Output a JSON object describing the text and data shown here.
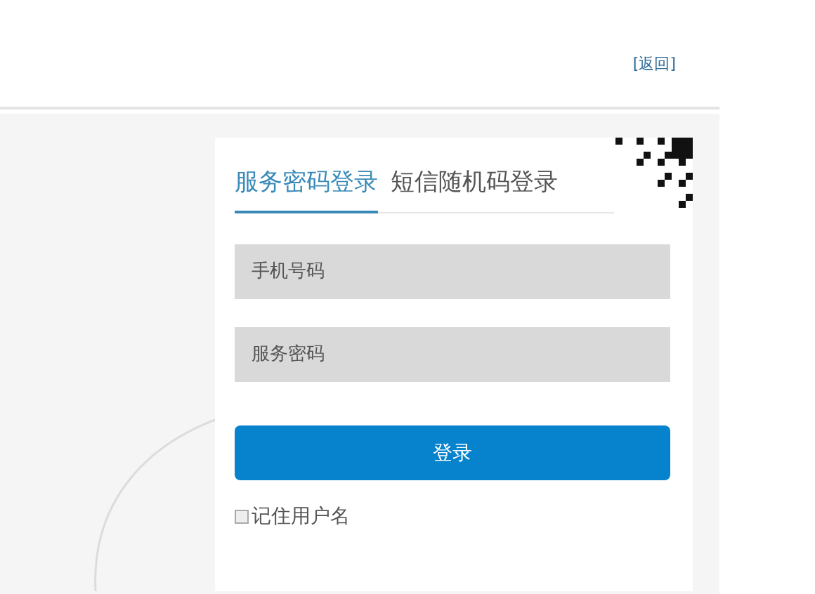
{
  "header": {
    "back_link": "[返回]"
  },
  "login": {
    "tabs": [
      {
        "label": "服务密码登录",
        "selected": true
      },
      {
        "label": "短信随机码登录",
        "selected": false
      }
    ],
    "fields": [
      {
        "placeholder": "手机号码"
      },
      {
        "placeholder": "服务密码"
      }
    ],
    "submit": "登录",
    "remember": {
      "label": "记住用户名",
      "checked": false
    }
  }
}
